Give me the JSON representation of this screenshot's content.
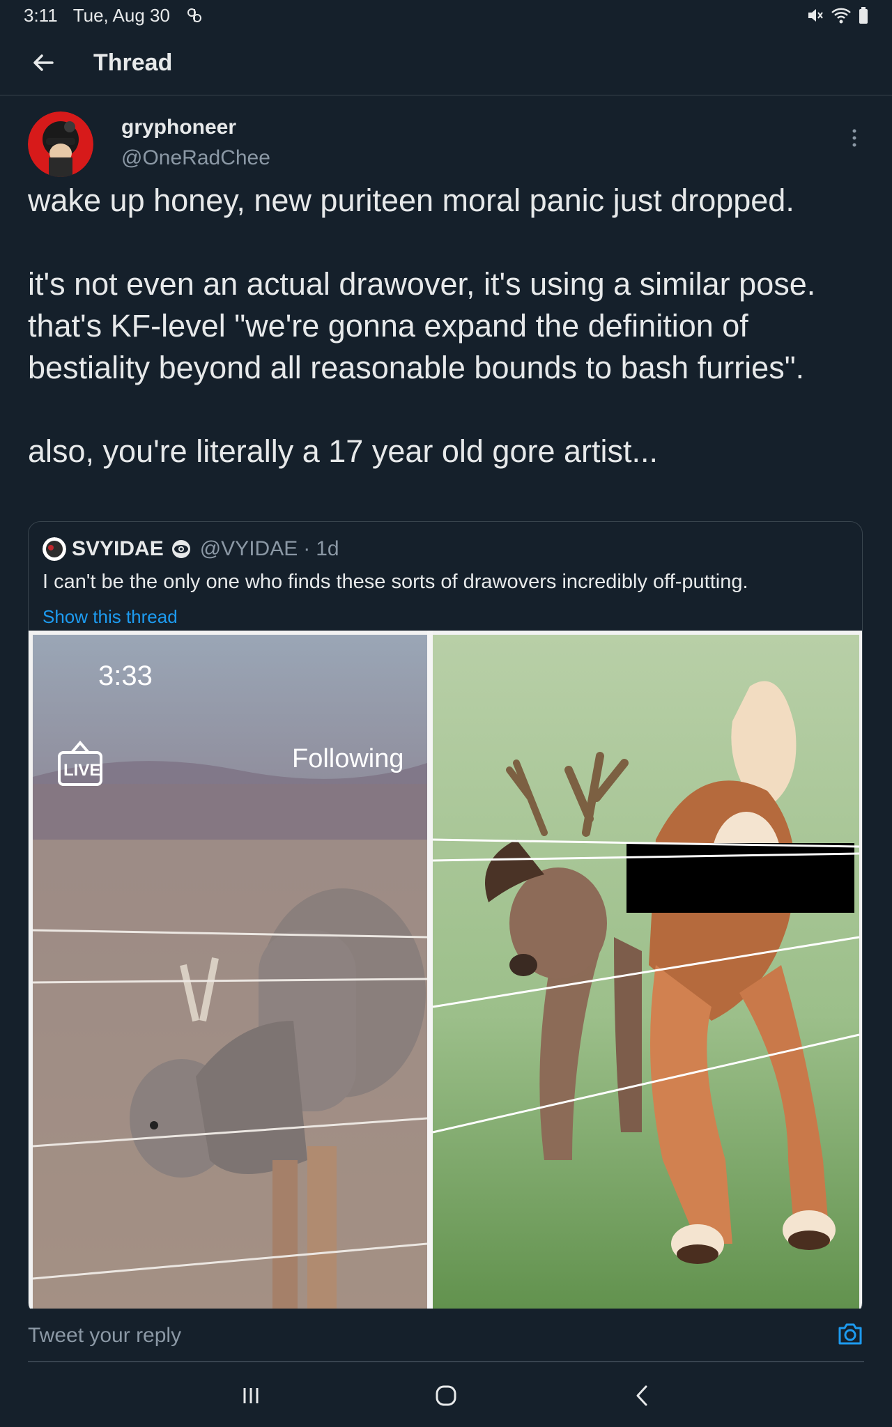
{
  "status_bar": {
    "time": "3:11",
    "date": "Tue, Aug 30"
  },
  "header": {
    "title": "Thread"
  },
  "tweet": {
    "display_name": "gryphoneer",
    "handle": "@OneRadChee",
    "text": "wake up honey, new puriteen moral panic just dropped.\n\nit's not even an actual drawover, it's using a similar pose. that's KF-level \"we're gonna expand the definition of bestiality beyond all reasonable bounds to bash furries\".\n\nalso, you're literally a 17 year old gore artist..."
  },
  "quote": {
    "display_name": "SVYIDAE",
    "handle": "@VYIDAE",
    "separator": "·",
    "age": "1d",
    "text": "I can't be the only one who finds these sorts of drawovers incredibly off-putting.",
    "show_thread": "Show this thread",
    "media": {
      "left_time": "3:33",
      "left_live": "LIVE",
      "left_following": "Following"
    }
  },
  "reply": {
    "placeholder": "Tweet your reply"
  },
  "colors": {
    "background": "#15202b",
    "accent": "#1d9bf0",
    "muted": "#8b98a5",
    "border": "#38444d"
  },
  "icons": [
    "back-arrow-icon",
    "more-vertical-icon",
    "camera-icon",
    "recents-icon",
    "home-icon",
    "back-nav-icon",
    "mute-icon",
    "wifi-icon",
    "battery-icon"
  ]
}
